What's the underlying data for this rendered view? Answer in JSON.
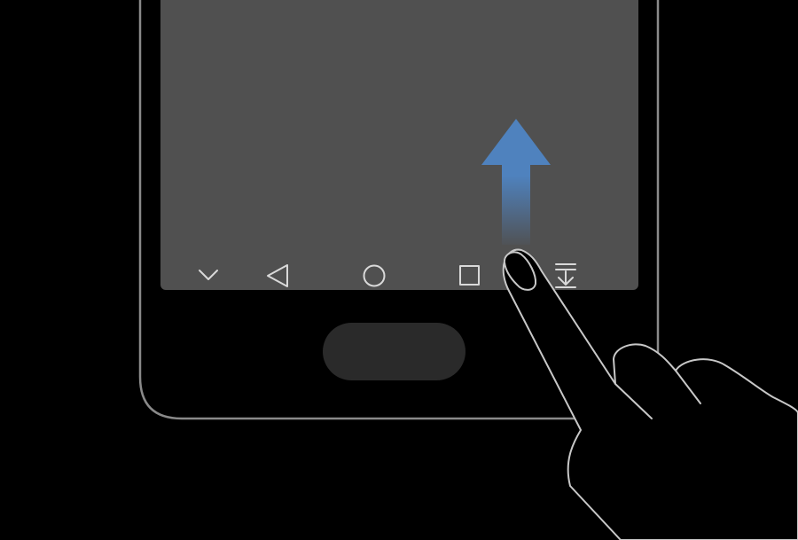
{
  "illustration": {
    "background_color": "#000000",
    "phone_outline_color": "#8a8a8a",
    "screen_color": "#505050",
    "home_button_color": "#2a2a2a",
    "nav_icon_color": "#d9d9d9",
    "hand_outline_color": "#c8c8c8",
    "hand_fill_color": "#000000",
    "arrow_color": "#4f82be",
    "gesture": "swipe-up"
  },
  "navigation_bar": {
    "buttons": [
      {
        "name": "hide-nav-bar",
        "icon": "chevron-down-icon"
      },
      {
        "name": "back",
        "icon": "triangle-back-icon"
      },
      {
        "name": "home",
        "icon": "circle-home-icon"
      },
      {
        "name": "recents",
        "icon": "square-recents-icon"
      },
      {
        "name": "notification-panel",
        "icon": "pull-down-notifications-icon"
      }
    ]
  }
}
